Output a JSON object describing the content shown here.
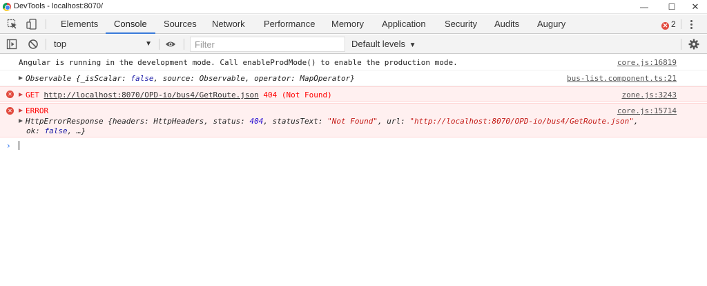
{
  "window": {
    "title": "DevTools - localhost:8070/",
    "min_glyph": "—",
    "max_glyph": "☐",
    "close_glyph": "✕"
  },
  "tabs": [
    {
      "label": "Elements",
      "active": false
    },
    {
      "label": "Console",
      "active": true
    },
    {
      "label": "Sources",
      "active": false
    },
    {
      "label": "Network",
      "active": false
    },
    {
      "label": "Performance",
      "active": false
    },
    {
      "label": "Memory",
      "active": false
    },
    {
      "label": "Application",
      "active": false
    },
    {
      "label": "Security",
      "active": false
    },
    {
      "label": "Audits",
      "active": false
    },
    {
      "label": "Augury",
      "active": false
    }
  ],
  "error_badge": {
    "icon_glyph": "✕",
    "count": "2"
  },
  "toolbar": {
    "context": "top",
    "caret": "▼",
    "filter_placeholder": "Filter",
    "levels_label": "Default levels",
    "levels_caret": "▼"
  },
  "messages": [
    {
      "type": "log",
      "text": "Angular is running in the development mode. Call enableProdMode() to enable the production mode.",
      "source": "core.js:16819"
    },
    {
      "type": "log",
      "expand": true,
      "object_prefix": "Observable {_isScalar: ",
      "object_false": "false",
      "object_mid": ", source: Observable, operator: MapOperator}",
      "source": "bus-list.component.ts:21"
    },
    {
      "type": "error",
      "method": "GET",
      "url": "http://localhost:8070/OPD-io/bus4/GetRoute.json",
      "status": "404 (Not Found)",
      "source": "zone.js:3243"
    },
    {
      "type": "error",
      "label": "ERROR",
      "source": "core.js:15714",
      "obj_a": "HttpErrorResponse {headers: HttpHeaders, status: ",
      "obj_status": "404",
      "obj_b": ", statusText: ",
      "obj_statustext": "\"Not Found\"",
      "obj_c": ", url: ",
      "obj_url": "\"http://localhost:8070/OPD-io/bus4/GetRoute.json\"",
      "obj_d": ",",
      "obj_e": "ok: ",
      "obj_false": "false",
      "obj_f": ", …}"
    }
  ],
  "prompt_glyph": "›",
  "colors": {
    "accent": "#3879d9",
    "error": "#ff0000",
    "error_bg": "#fff0f0",
    "prompt": "#367cf1"
  }
}
